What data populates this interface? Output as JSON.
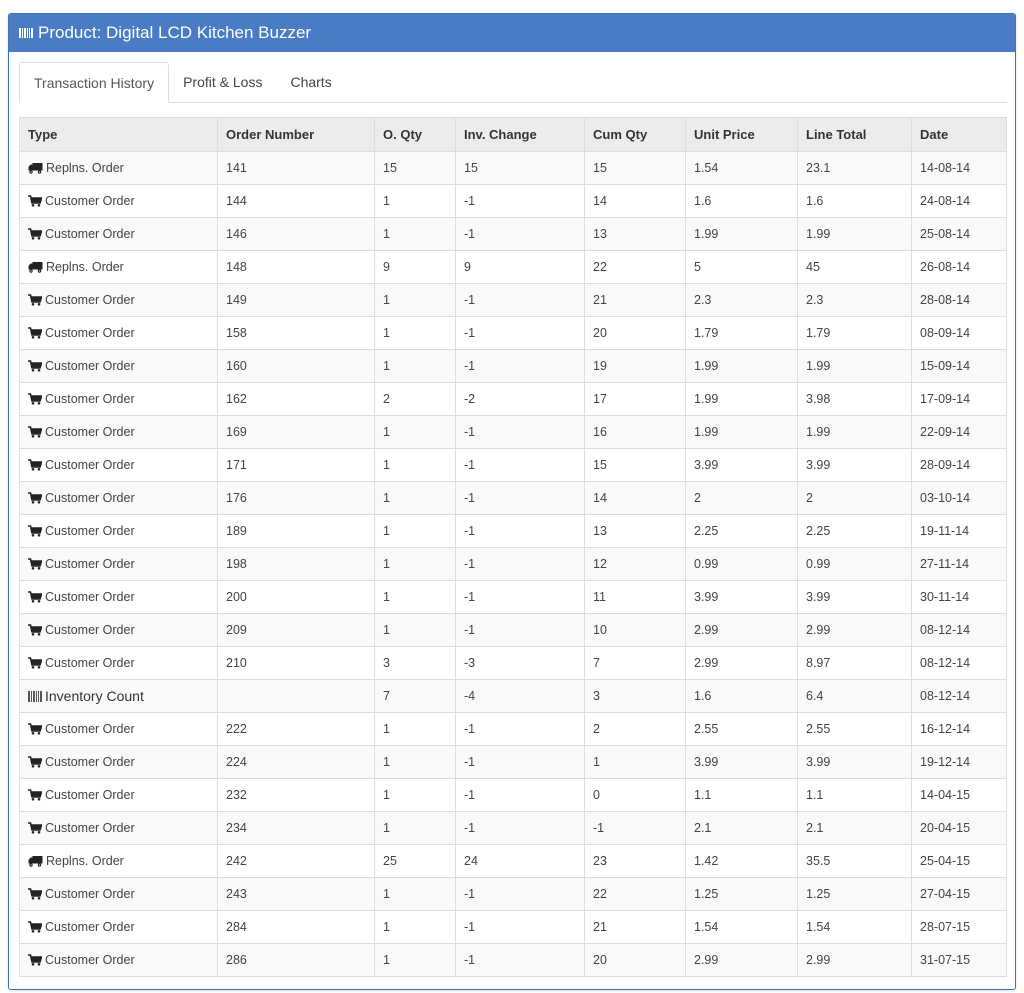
{
  "panel": {
    "title": "Product: Digital LCD Kitchen Buzzer",
    "title_icon": "barcode-icon"
  },
  "tabs": [
    {
      "label": "Transaction History",
      "active": true
    },
    {
      "label": "Profit & Loss",
      "active": false
    },
    {
      "label": "Charts",
      "active": false
    }
  ],
  "table": {
    "headers": [
      "Type",
      "Order Number",
      "O. Qty",
      "Inv. Change",
      "Cum Qty",
      "Unit Price",
      "Line Total",
      "Date"
    ],
    "rows": [
      {
        "icon": "truck-icon",
        "type": "Replns. Order",
        "order": "141",
        "oqty": "15",
        "inv": "15",
        "cum": "15",
        "price": "1.54",
        "total": "23.1",
        "date": "14-08-14"
      },
      {
        "icon": "cart-icon",
        "type": "Customer Order",
        "order": "144",
        "oqty": "1",
        "inv": "-1",
        "cum": "14",
        "price": "1.6",
        "total": "1.6",
        "date": "24-08-14"
      },
      {
        "icon": "cart-icon",
        "type": "Customer Order",
        "order": "146",
        "oqty": "1",
        "inv": "-1",
        "cum": "13",
        "price": "1.99",
        "total": "1.99",
        "date": "25-08-14"
      },
      {
        "icon": "truck-icon",
        "type": "Replns. Order",
        "order": "148",
        "oqty": "9",
        "inv": "9",
        "cum": "22",
        "price": "5",
        "total": "45",
        "date": "26-08-14"
      },
      {
        "icon": "cart-icon",
        "type": "Customer Order",
        "order": "149",
        "oqty": "1",
        "inv": "-1",
        "cum": "21",
        "price": "2.3",
        "total": "2.3",
        "date": "28-08-14"
      },
      {
        "icon": "cart-icon",
        "type": "Customer Order",
        "order": "158",
        "oqty": "1",
        "inv": "-1",
        "cum": "20",
        "price": "1.79",
        "total": "1.79",
        "date": "08-09-14"
      },
      {
        "icon": "cart-icon",
        "type": "Customer Order",
        "order": "160",
        "oqty": "1",
        "inv": "-1",
        "cum": "19",
        "price": "1.99",
        "total": "1.99",
        "date": "15-09-14"
      },
      {
        "icon": "cart-icon",
        "type": "Customer Order",
        "order": "162",
        "oqty": "2",
        "inv": "-2",
        "cum": "17",
        "price": "1.99",
        "total": "3.98",
        "date": "17-09-14"
      },
      {
        "icon": "cart-icon",
        "type": "Customer Order",
        "order": "169",
        "oqty": "1",
        "inv": "-1",
        "cum": "16",
        "price": "1.99",
        "total": "1.99",
        "date": "22-09-14"
      },
      {
        "icon": "cart-icon",
        "type": "Customer Order",
        "order": "171",
        "oqty": "1",
        "inv": "-1",
        "cum": "15",
        "price": "3.99",
        "total": "3.99",
        "date": "28-09-14"
      },
      {
        "icon": "cart-icon",
        "type": "Customer Order",
        "order": "176",
        "oqty": "1",
        "inv": "-1",
        "cum": "14",
        "price": "2",
        "total": "2",
        "date": "03-10-14"
      },
      {
        "icon": "cart-icon",
        "type": "Customer Order",
        "order": "189",
        "oqty": "1",
        "inv": "-1",
        "cum": "13",
        "price": "2.25",
        "total": "2.25",
        "date": "19-11-14"
      },
      {
        "icon": "cart-icon",
        "type": "Customer Order",
        "order": "198",
        "oqty": "1",
        "inv": "-1",
        "cum": "12",
        "price": "0.99",
        "total": "0.99",
        "date": "27-11-14"
      },
      {
        "icon": "cart-icon",
        "type": "Customer Order",
        "order": "200",
        "oqty": "1",
        "inv": "-1",
        "cum": "11",
        "price": "3.99",
        "total": "3.99",
        "date": "30-11-14"
      },
      {
        "icon": "cart-icon",
        "type": "Customer Order",
        "order": "209",
        "oqty": "1",
        "inv": "-1",
        "cum": "10",
        "price": "2.99",
        "total": "2.99",
        "date": "08-12-14"
      },
      {
        "icon": "cart-icon",
        "type": "Customer Order",
        "order": "210",
        "oqty": "3",
        "inv": "-3",
        "cum": "7",
        "price": "2.99",
        "total": "8.97",
        "date": "08-12-14"
      },
      {
        "icon": "barcode-icon",
        "type": "Inventory Count",
        "order": "",
        "oqty": "7",
        "inv": "-4",
        "cum": "3",
        "price": "1.6",
        "total": "6.4",
        "date": "08-12-14"
      },
      {
        "icon": "cart-icon",
        "type": "Customer Order",
        "order": "222",
        "oqty": "1",
        "inv": "-1",
        "cum": "2",
        "price": "2.55",
        "total": "2.55",
        "date": "16-12-14"
      },
      {
        "icon": "cart-icon",
        "type": "Customer Order",
        "order": "224",
        "oqty": "1",
        "inv": "-1",
        "cum": "1",
        "price": "3.99",
        "total": "3.99",
        "date": "19-12-14"
      },
      {
        "icon": "cart-icon",
        "type": "Customer Order",
        "order": "232",
        "oqty": "1",
        "inv": "-1",
        "cum": "0",
        "price": "1.1",
        "total": "1.1",
        "date": "14-04-15"
      },
      {
        "icon": "cart-icon",
        "type": "Customer Order",
        "order": "234",
        "oqty": "1",
        "inv": "-1",
        "cum": "-1",
        "price": "2.1",
        "total": "2.1",
        "date": "20-04-15"
      },
      {
        "icon": "truck-icon",
        "type": "Replns. Order",
        "order": "242",
        "oqty": "25",
        "inv": "24",
        "cum": "23",
        "price": "1.42",
        "total": "35.5",
        "date": "25-04-15"
      },
      {
        "icon": "cart-icon",
        "type": "Customer Order",
        "order": "243",
        "oqty": "1",
        "inv": "-1",
        "cum": "22",
        "price": "1.25",
        "total": "1.25",
        "date": "27-04-15"
      },
      {
        "icon": "cart-icon",
        "type": "Customer Order",
        "order": "284",
        "oqty": "1",
        "inv": "-1",
        "cum": "21",
        "price": "1.54",
        "total": "1.54",
        "date": "28-07-15"
      },
      {
        "icon": "cart-icon",
        "type": "Customer Order",
        "order": "286",
        "oqty": "1",
        "inv": "-1",
        "cum": "20",
        "price": "2.99",
        "total": "2.99",
        "date": "31-07-15"
      }
    ]
  },
  "colors": {
    "header_bg": "#4a7cc6",
    "table_head_bg": "#ececec",
    "stripe_bg": "#f9f9f9"
  }
}
